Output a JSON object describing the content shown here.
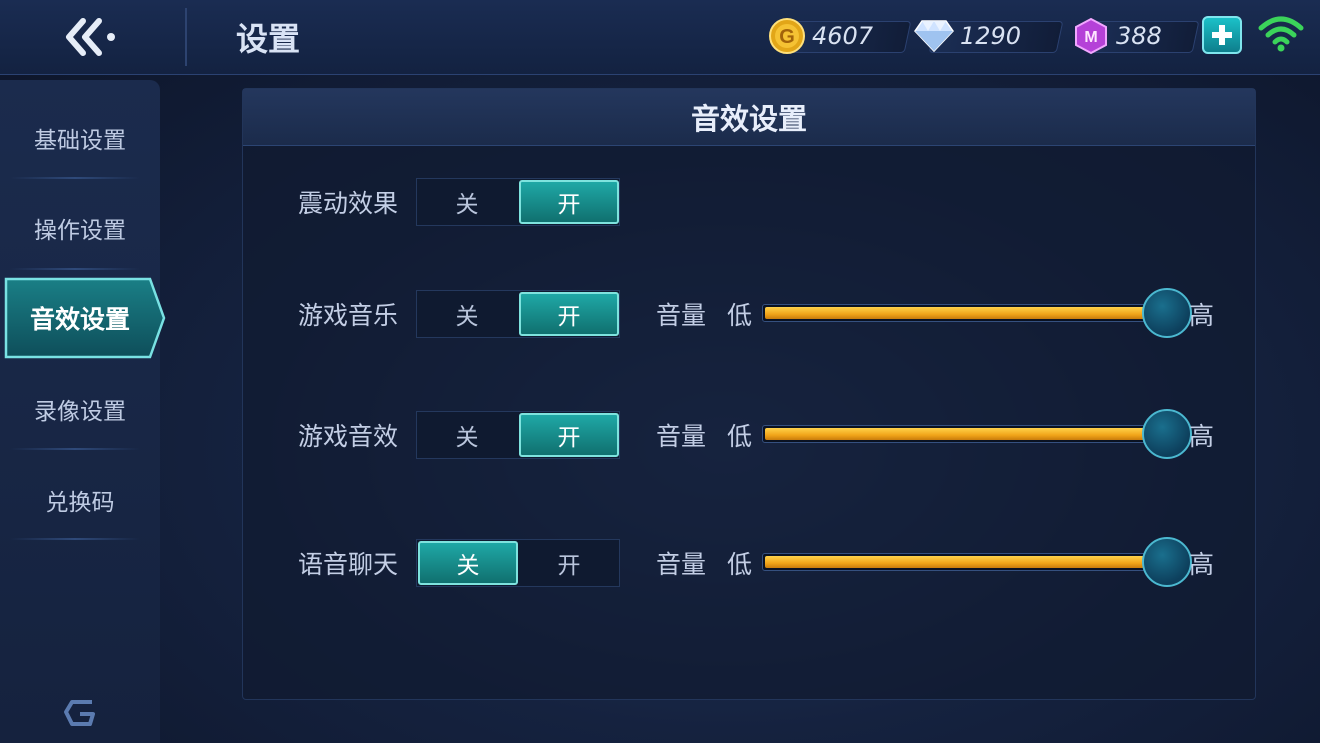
{
  "header": {
    "title": "设置",
    "currencies": [
      {
        "icon": "gold-coin-icon",
        "value": "4607"
      },
      {
        "icon": "diamond-icon",
        "value": "1290"
      },
      {
        "icon": "purple-gem-icon",
        "value": "388"
      }
    ]
  },
  "sidebar": {
    "items": [
      {
        "label": "基础设置"
      },
      {
        "label": "操作设置"
      },
      {
        "label": "音效设置",
        "active": true
      },
      {
        "label": "录像设置"
      },
      {
        "label": "兑换码"
      }
    ]
  },
  "panel": {
    "title": "音效设置",
    "rows": [
      {
        "label": "震动效果",
        "off_label": "关",
        "on_label": "开",
        "state": "on"
      },
      {
        "label": "游戏音乐",
        "off_label": "关",
        "on_label": "开",
        "state": "on",
        "volume": {
          "label": "音量",
          "low": "低",
          "high": "高",
          "level": 1.0
        }
      },
      {
        "label": "游戏音效",
        "off_label": "关",
        "on_label": "开",
        "state": "on",
        "volume": {
          "label": "音量",
          "low": "低",
          "high": "高",
          "level": 1.0
        }
      },
      {
        "label": "语音聊天",
        "off_label": "关",
        "on_label": "开",
        "state": "off",
        "volume": {
          "label": "音量",
          "low": "低",
          "high": "高",
          "level": 1.0
        }
      }
    ]
  },
  "colors": {
    "accent_teal": "#1fa8a6",
    "slider_gold": "#f0a419",
    "wifi_green": "#3bd35a"
  }
}
